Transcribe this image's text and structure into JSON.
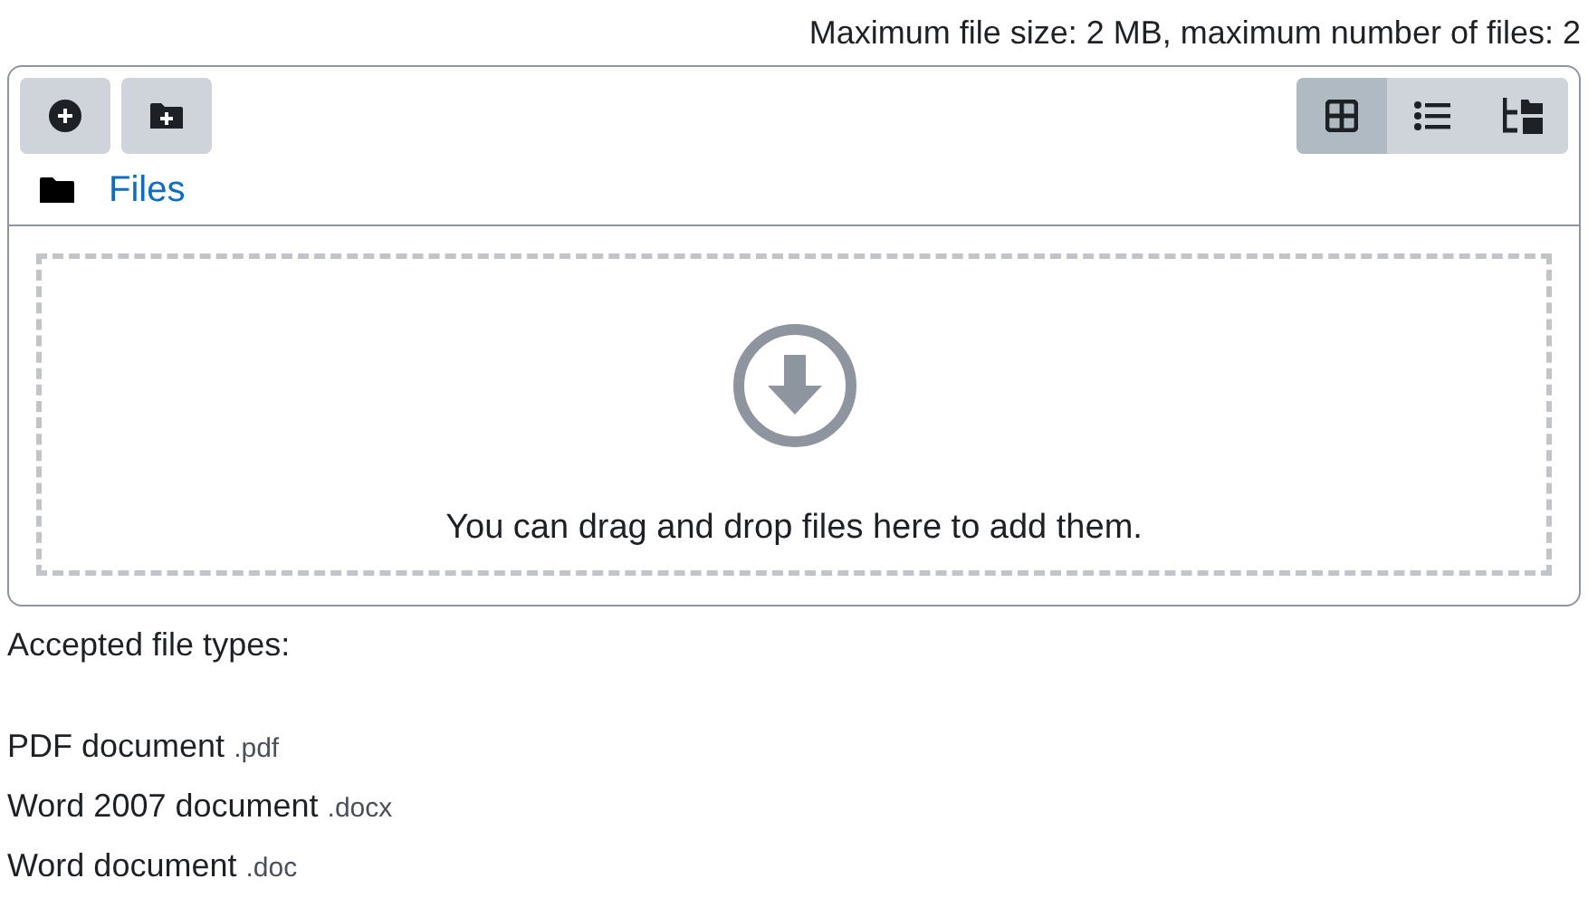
{
  "limits": "Maximum file size: 2 MB, maximum number of files: 2",
  "toolbar": {
    "actions": [
      {
        "kind": "add-file"
      },
      {
        "kind": "add-folder"
      }
    ],
    "views": [
      {
        "kind": "grid",
        "selected": true
      },
      {
        "kind": "list",
        "selected": false
      },
      {
        "kind": "tree",
        "selected": false
      }
    ]
  },
  "breadcrumb": "Files",
  "dropzone": "You can drag and drop files here to add them.",
  "accepted_label": "Accepted file types:",
  "file_types": [
    {
      "name": "PDF document",
      "ext": ".pdf"
    },
    {
      "name": "Word 2007 document",
      "ext": ".docx"
    },
    {
      "name": "Word document",
      "ext": ".doc"
    }
  ]
}
